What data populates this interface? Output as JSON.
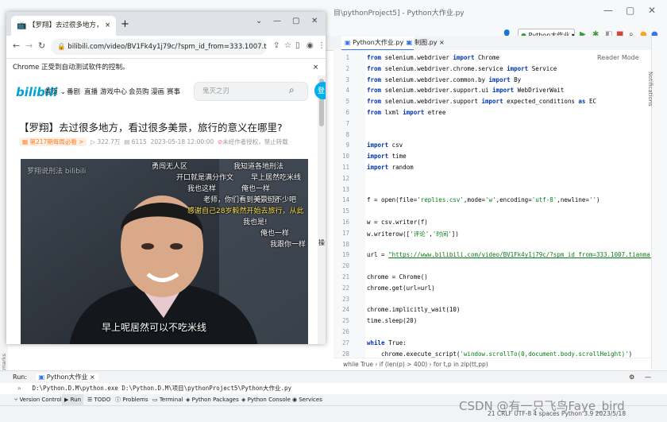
{
  "ide": {
    "title_partial": "目\\pythonProject5] - Python大作业.py",
    "window_controls": [
      "—",
      "▢",
      "✕"
    ],
    "run_config": "Python大作业",
    "tabs": [
      "Python大作业.py",
      "制图.py"
    ],
    "reader_mode": "Reader Mode",
    "notifications": "Notifications",
    "line_numbers": [
      "1",
      "2",
      "3",
      "4",
      "5",
      "6",
      "7",
      "8",
      "9",
      "10",
      "11",
      "12",
      "13",
      "14",
      "15",
      "16",
      "17",
      "18",
      "19",
      "20",
      "21",
      "22",
      "23",
      "24",
      "25",
      "26",
      "27",
      "28"
    ],
    "code": {
      "l1": [
        "from",
        " selenium.webdriver ",
        "import",
        " Chrome"
      ],
      "l2": [
        "from",
        " selenium.webdriver.chrome.service ",
        "import",
        " Service"
      ],
      "l3": [
        "from",
        " selenium.webdriver.common.by ",
        "import",
        " By"
      ],
      "l4": [
        "from",
        " selenium.webdriver.support.ui ",
        "import",
        " WebDriverWait"
      ],
      "l5": [
        "from",
        " selenium.webdriver.support ",
        "import",
        " expected_conditions ",
        "as",
        " EC"
      ],
      "l6": [
        "from",
        " lxml ",
        "import",
        " etree"
      ],
      "l9": [
        "import",
        " csv"
      ],
      "l10": [
        "import",
        " time"
      ],
      "l11": [
        "import",
        " random"
      ],
      "l14": [
        "f = open(file=",
        "'replies.csv'",
        ",mode=",
        "'w'",
        ",encoding=",
        "'utf-8'",
        ",newline=",
        "''",
        ")"
      ],
      "l16": "w = csv.writer(f)",
      "l17": [
        "w.writerow([",
        "'评论'",
        ",",
        "'时间'",
        "])"
      ],
      "l19": [
        "url = ",
        "\"https://www.bilibili.com/video/BV1Fk4y1j79c/?spm_id_from=333.1007.tianma.2-1"
      ],
      "l21": "chrome = Chrome()",
      "l22": "chrome.get(url=url)",
      "l24": "chrome.implicitly_wait(10)",
      "l25": "time.sleep(20)",
      "l27": [
        "while",
        " True:"
      ],
      "l28": [
        "    chrome.execute_script(",
        "'window.scrollTo(0,document.body.scrollHeight)'",
        ")"
      ]
    },
    "breadcrumb": "while True  ›  if (len(p) > 400)  ›  for t,p in zip(tt,pp)",
    "run_label": "Run:",
    "run_tab": "Python大作业",
    "run_command": "D:\\Python.D.M\\python.exe D:\\Python.D.M\\项目\\pythonProject5\\Python大作业.py",
    "tool_tabs": [
      "Version Control",
      "Run",
      "TODO",
      "Problems",
      "Terminal",
      "Python Packages",
      "Python Console",
      "Services"
    ],
    "status_right": "21   CRLF   UTF-8   4 spaces   Python 3.9   2023/5/18",
    "watermark": "CSDN @有一只飞鸟Faye_bird",
    "left_strip_label": "Bookmarks"
  },
  "chrome": {
    "tab_title": "【罗翔】去过很多地方，看过很",
    "tab_close": "×",
    "new_tab": "+",
    "window_controls": [
      "⌄",
      "—",
      "▢",
      "✕"
    ],
    "url": "bilibili.com/video/BV1Fk4y1j79c/?spm_id_from=333.1007.tian...",
    "infobar_text": "Chrome 正受到自动测试软件的控制。",
    "infobar_close": "×"
  },
  "bilibili": {
    "logo": "bilibili",
    "nav": [
      "首页",
      "番剧",
      "直播",
      "游戏中心",
      "会员购",
      "漫画",
      "赛事"
    ],
    "search_placeholder": "鬼灭之刃",
    "login_label": "登",
    "video_title": "【罗翔】去过很多地方，看过很多美景，旅行的意义在哪里?",
    "badge": "第217期每周必看 >",
    "views": "322.7万",
    "danmaku_count": "6115",
    "date": "2023-05-18 12:00:00",
    "copyright": "未经作者授权，禁止转载",
    "video_logo": "罗翔说刑法 bilibili",
    "danmaku": [
      "勇闯无人区",
      "我知道各地刑法",
      "开口就是满分作文",
      "早上居然吃米线",
      "我也这样",
      "俺也一样",
      "我也是",
      "老师，你们看到美景可不少吧",
      "感谢自己28岁毅然开始去旅行，从此",
      "我也是!",
      "俺也一样",
      "我跟你一样"
    ],
    "subtitle": "早上呢居然可以不吃米线",
    "side_label": "操"
  },
  "colors": {
    "bili_blue": "#00a1d6",
    "keyword": "#0033b3",
    "string": "#067d17",
    "accent": "#3574f0"
  }
}
